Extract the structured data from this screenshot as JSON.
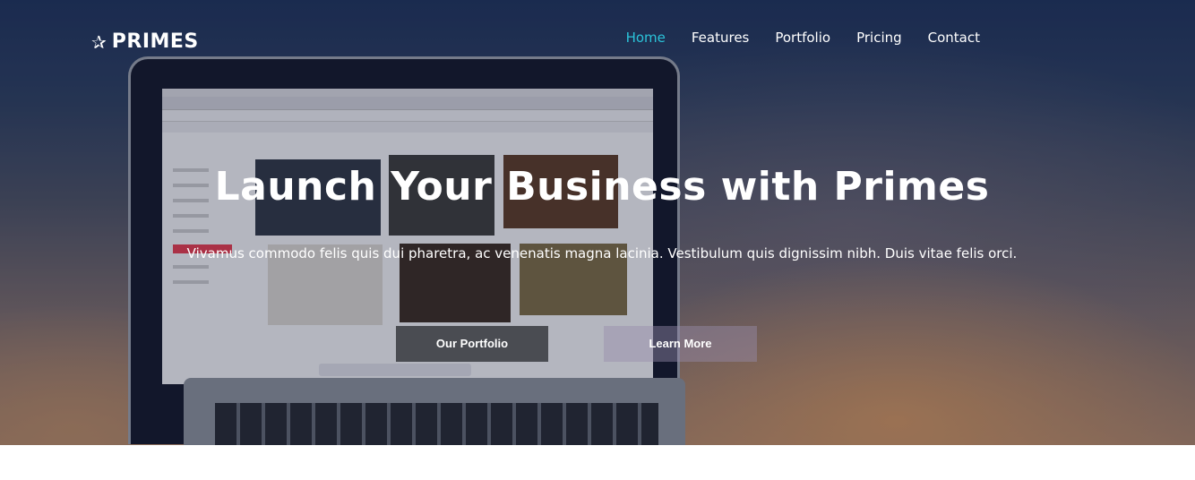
{
  "brand": {
    "icon": "star-icon",
    "name": "PRIMES"
  },
  "nav": {
    "items": [
      "Home",
      "Features",
      "Portfolio",
      "Pricing",
      "Contact"
    ],
    "active": "Home"
  },
  "hero": {
    "title": "Launch Your Business with Primes",
    "subtitle": "Vivamus commodo felis quis dui pharetra, ac venenatis magna lacinia. Vestibulum quis dignissim nibh. Duis vitae felis orci.",
    "primary_button": "Our Portfolio",
    "secondary_button": "Learn More"
  },
  "colors": {
    "accent": "#2bc3d9",
    "primary_button": "#4a4c52"
  }
}
